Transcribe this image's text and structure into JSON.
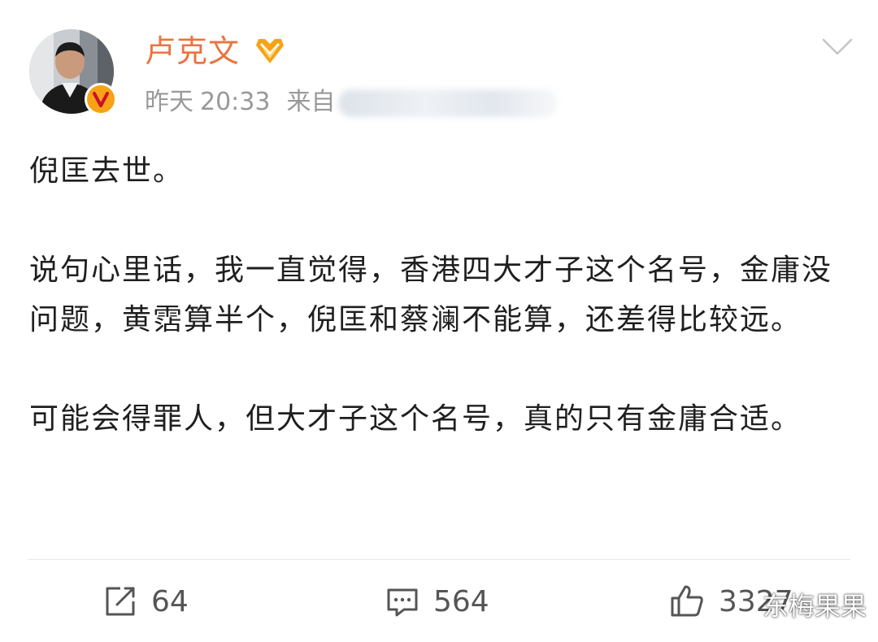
{
  "post": {
    "username": "卢克文",
    "day": "昨天",
    "time": "20:33",
    "source_prefix": "来自",
    "paragraphs": [
      "倪匡去世。",
      "说句心里话，我一直觉得，香港四大才子这个名号，金庸没问题，黄霑算半个，倪匡和蔡澜不能算，还差得比较远。",
      "可能会得罪人，但大才子这个名号，真的只有金庸合适。"
    ]
  },
  "actions": {
    "repost_count": "64",
    "comment_count": "564",
    "like_count": "3327"
  },
  "watermark": "东梅果果",
  "icons": {
    "badge": "verified-v-icon",
    "vip": "vip-diamond-icon",
    "menu": "chevron-down-icon",
    "repost": "repost-icon",
    "comment": "comment-icon",
    "like": "thumbs-up-icon"
  },
  "colors": {
    "username": "#eb7340",
    "meta": "#999999",
    "text": "#1f1f1f",
    "badge": "#f7a315",
    "action": "#555555"
  }
}
